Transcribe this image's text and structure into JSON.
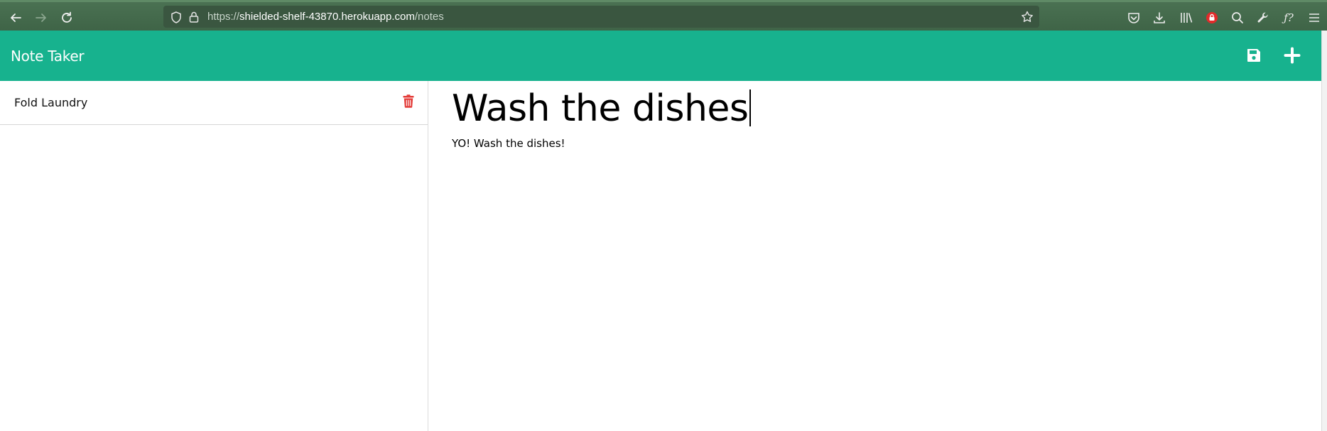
{
  "browser": {
    "url_prefix": "https://",
    "url_domain": "shielded-shelf-43870.herokuapp.com",
    "url_path": "/notes",
    "icons": {
      "back": "arrow-left-icon",
      "forward": "arrow-right-icon",
      "reload": "reload-icon",
      "shield": "shield-icon",
      "lock": "lock-icon",
      "bookmark": "star-icon",
      "pocket": "pocket-icon",
      "downloads": "download-icon",
      "library": "library-icon",
      "extension": "extension-lock-icon",
      "search": "search-icon",
      "devtools": "wrench-icon",
      "function": "function-icon",
      "menu": "hamburger-menu-icon"
    }
  },
  "app": {
    "title": "Note Taker",
    "brand_color": "#17b28e",
    "save_icon": "save-icon",
    "new_icon": "plus-icon"
  },
  "notes_list": [
    {
      "title": "Fold Laundry",
      "delete_icon": "trash-icon",
      "delete_color": "#e43e3b"
    }
  ],
  "editor": {
    "title": "Wash the dishes",
    "text": "YO! Wash the dishes!"
  }
}
